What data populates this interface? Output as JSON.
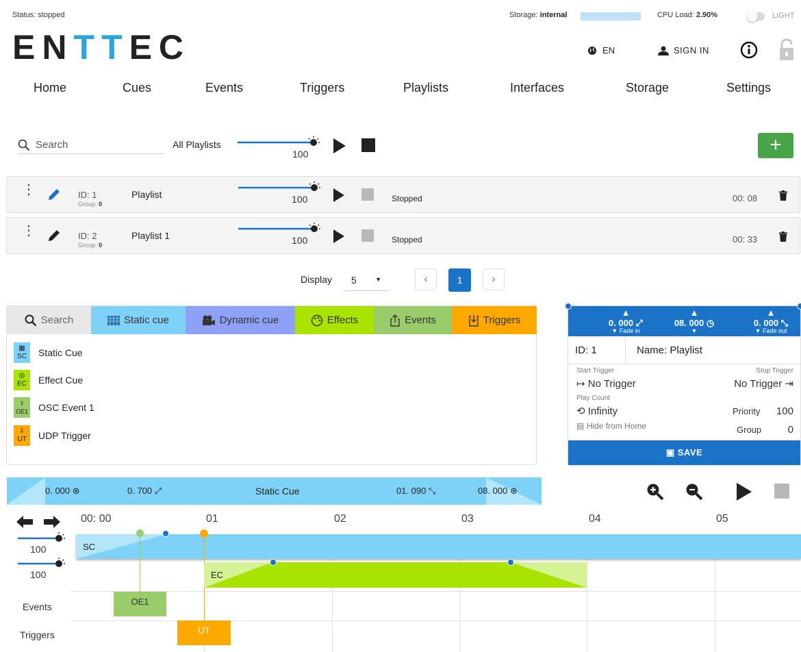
{
  "topbar": {
    "status": "Status: stopped",
    "storage_label": "Storage:",
    "storage_value": "internal",
    "cpu_label": "CPU Load:",
    "cpu_value": "2.90%",
    "theme_label": "LIGHT"
  },
  "logo": {
    "part1": "EN",
    "part2": "TT",
    "part3": "EC"
  },
  "header": {
    "language": "EN",
    "sign_in": "SIGN IN"
  },
  "nav": [
    "Home",
    "Cues",
    "Events",
    "Triggers",
    "Playlists",
    "Interfaces",
    "Storage",
    "Settings"
  ],
  "playlists_bar": {
    "search_placeholder": "Search",
    "all_label": "All Playlists",
    "master_level": "100",
    "add_label": "+"
  },
  "playlists": [
    {
      "id": "ID: 1",
      "group_label": "Group:",
      "group": "0",
      "name": "Playlist",
      "level": "100",
      "status": "Stopped",
      "duration": "00: 08"
    },
    {
      "id": "ID: 2",
      "group_label": "Group:",
      "group": "0",
      "name": "Playlist 1",
      "level": "100",
      "status": "Stopped",
      "duration": "00: 33"
    }
  ],
  "pagination": {
    "display_label": "Display",
    "page_size": "5",
    "prev": "‹",
    "current": "1",
    "next": "›"
  },
  "cue_tabs": {
    "search": "Search",
    "static": "Static cue",
    "dynamic": "Dynamic cue",
    "effects": "Effects",
    "events": "Events",
    "triggers": "Triggers"
  },
  "cue_list": [
    {
      "abbr": "SC",
      "name": "Static Cue",
      "color": "#7fd2f7"
    },
    {
      "abbr": "EC",
      "name": "Effect Cue",
      "color": "#a9e300"
    },
    {
      "abbr": "OE1",
      "name": "OSC Event 1",
      "color": "#9bcc6b"
    },
    {
      "abbr": "UT",
      "name": "UDP Trigger",
      "color": "#ffa800"
    }
  ],
  "editor": {
    "fade_in": "0. 000",
    "fade_in_label": "Fade in",
    "wait": "08. 000",
    "fade_out": "0. 000",
    "fade_out_label": "Fade out",
    "id_label": "ID:",
    "id": "1",
    "name_label": "Name:",
    "name": "Playlist",
    "start_trigger_label": "Start Trigger",
    "start_trigger": "No Trigger",
    "stop_trigger_label": "Stop Trigger",
    "stop_trigger": "No Trigger",
    "play_count_label": "Play Count",
    "play_count": "Infinity",
    "priority_label": "Priority",
    "priority": "100",
    "hide_label": "Hide from Home",
    "group_label": "Group",
    "group": "0",
    "save": "SAVE"
  },
  "cue_bar": {
    "delay": "0. 000",
    "fade_in": "0. 700",
    "name": "Static Cue",
    "fade_out": "01. 090",
    "hold": "08. 000"
  },
  "timeline": {
    "ticks": [
      "00: 00",
      "01",
      "02",
      "03",
      "04",
      "05"
    ],
    "tracks": [
      {
        "label": "SC",
        "level": "100"
      },
      {
        "label": "EC",
        "level": "100"
      }
    ],
    "events_label": "Events",
    "triggers_label": "Triggers",
    "event_block": "OE1",
    "trigger_block": "UT"
  },
  "colors": {
    "primary": "#1a73c7",
    "add": "#47a447",
    "static": "#7fd2f7",
    "dynamic": "#8fa0f7",
    "effect": "#a9e300",
    "event": "#9bcc6b",
    "trigger": "#ffa800",
    "logo_accent": "#2aa7df"
  }
}
